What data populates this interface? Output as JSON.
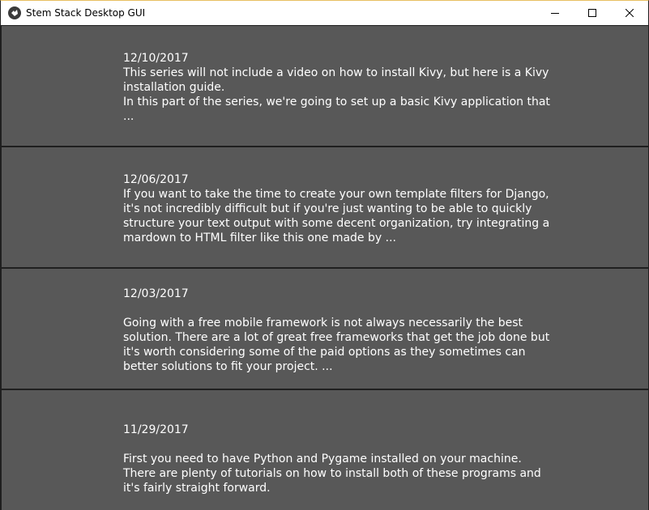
{
  "window": {
    "title": "Stem Stack Desktop GUI"
  },
  "posts": [
    {
      "date": "12/10/2017",
      "lines": [
        "This series will not include a video on how to install Kivy, but here is a Kivy",
        "installation guide.",
        "In this part of the series, we're going to set up a basic Kivy application that",
        "..."
      ]
    },
    {
      "date": "12/06/2017",
      "lines": [
        "If you want to take the time to create your own template filters for Django,",
        "it's not incredibly difficult but if you're just wanting to be able to quickly",
        "structure your text output with some decent organization, try integrating a",
        "mardown to HTML filter like this one made by ..."
      ]
    },
    {
      "date": "12/03/2017",
      "lines": [
        "Going with a free mobile framework is not always necessarily the best",
        "solution. There are a lot of great free frameworks that get the job done but",
        "it's worth considering some of the paid options as they sometimes can",
        "better solutions to fit your project. ..."
      ]
    },
    {
      "date": "11/29/2017",
      "lines": [
        "First you need to have Python and Pygame installed on your machine.",
        "There are plenty of tutorials on how to install both of these programs and",
        "it's fairly straight forward."
      ]
    }
  ]
}
